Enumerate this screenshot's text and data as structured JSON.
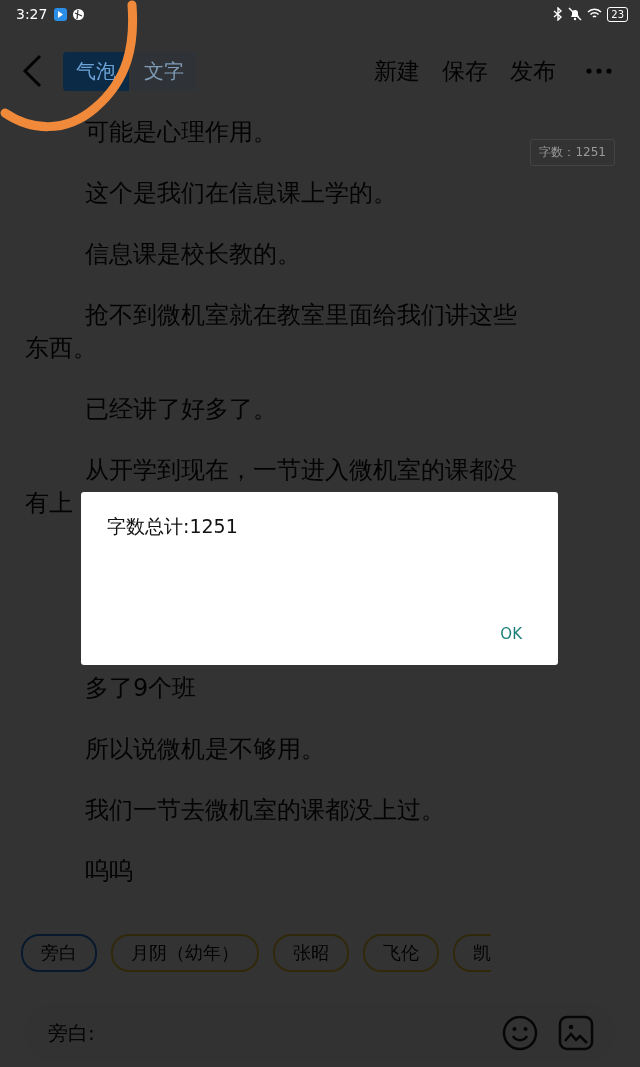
{
  "status_bar": {
    "time": "3:27",
    "battery": "23"
  },
  "header": {
    "tabs": [
      {
        "label": "气泡",
        "selected": true
      },
      {
        "label": "文字",
        "selected": false
      }
    ],
    "actions": [
      "新建",
      "保存",
      "发布"
    ]
  },
  "word_count_badge": "字数：1251",
  "paragraphs": [
    "可能是心理作用。",
    "这个是我们在信息课上学的。",
    "信息课是校长教的。",
    "抢不到微机室就在教室里面给我们讲这些东西。",
    "已经讲了好多了。",
    "从开学到现在，一节进入微机室的课都没有上",
    "多了9个班",
    "所以说微机是不够用。",
    "我们一节去微机室的课都没上过。",
    "呜呜"
  ],
  "roles": [
    {
      "label": "旁白",
      "selected": true
    },
    {
      "label": "月阴（幼年）",
      "selected": false
    },
    {
      "label": "张昭",
      "selected": false
    },
    {
      "label": "飞伦",
      "selected": false
    },
    {
      "label": "凯",
      "selected": false
    }
  ],
  "input": {
    "placeholder": "旁白:"
  },
  "dialog": {
    "message": "字数总计:1251",
    "button": "OK"
  }
}
